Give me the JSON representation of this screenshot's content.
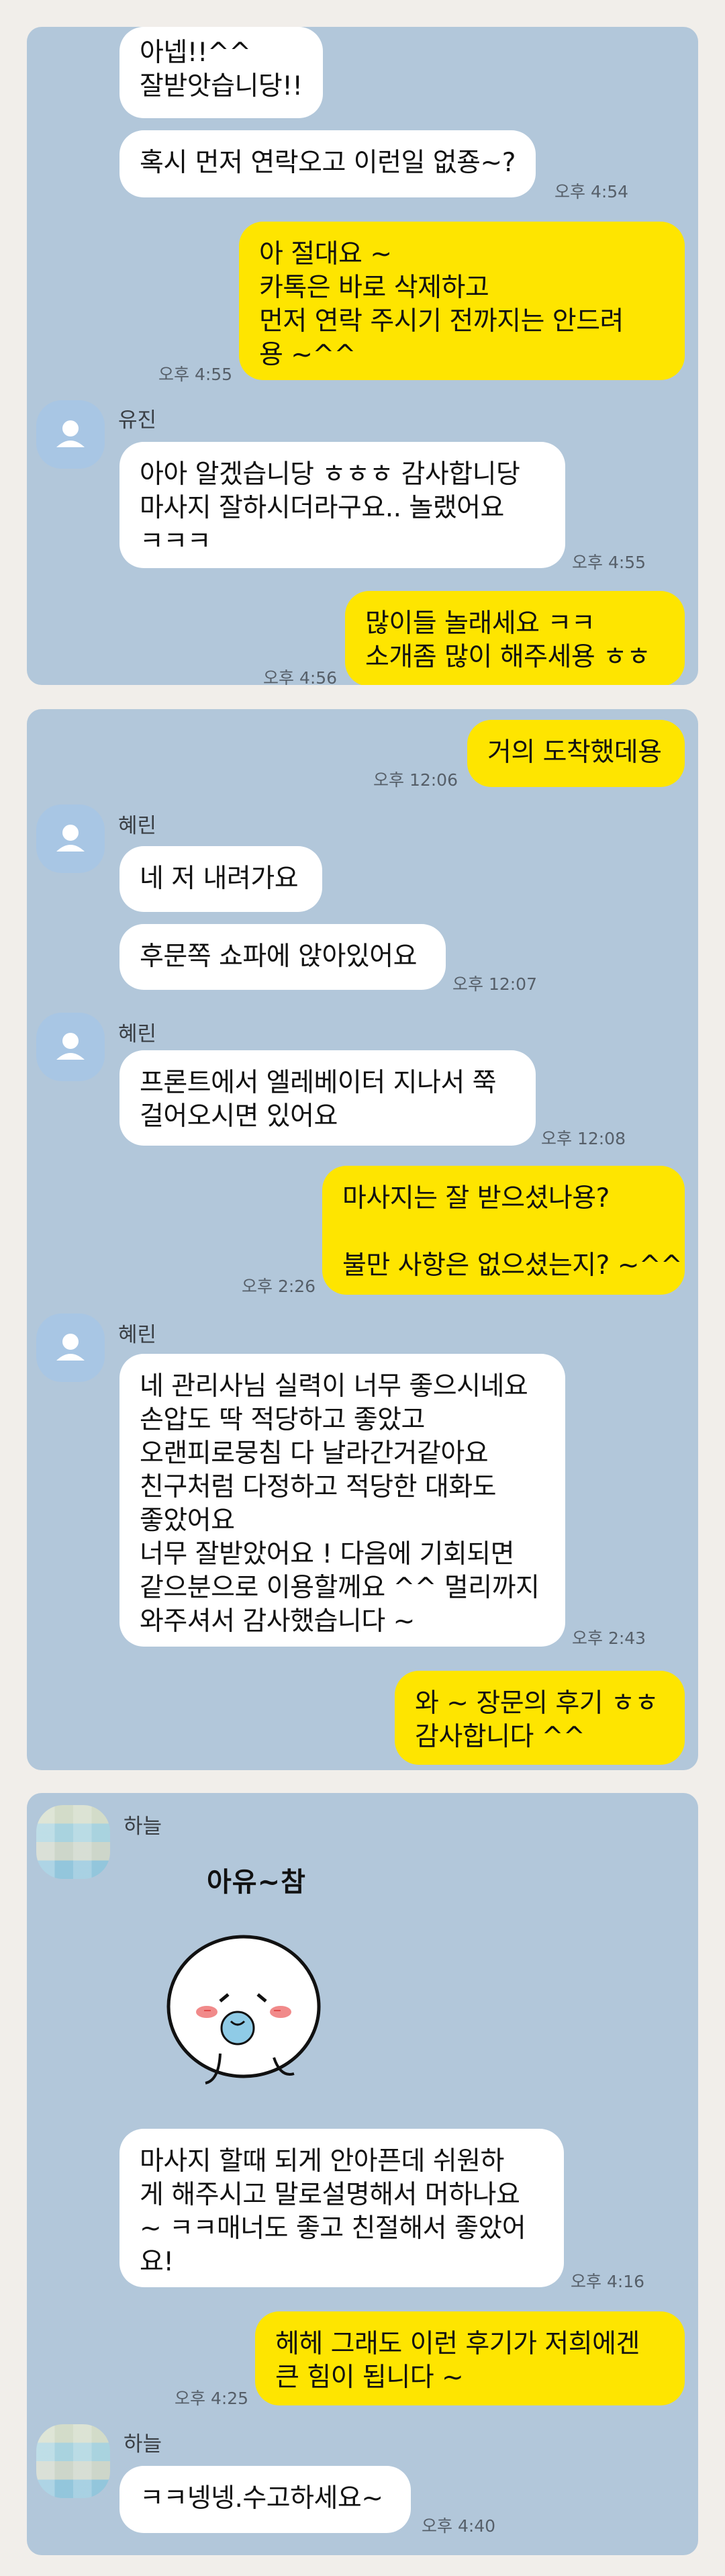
{
  "colors": {
    "chat_bg": "#b2c7da",
    "sent_bubble": "#fee500",
    "received_bubble": "#ffffff",
    "page_bg": "#f1eeea"
  },
  "icons": {
    "default_avatar": "person-icon",
    "blurred_avatar": "pixelated-profile-image"
  },
  "panel1": {
    "m1": "아넵!!^^\n잘받앗습니당!!",
    "m2": "혹시 먼저 연락오고 이런일 없죵~?",
    "t2": "오후 4:54",
    "m3": "아 절대요 ~\n카톡은 바로 삭제하고\n먼저 연락 주시기 전까지는 안드려\n용 ~^^",
    "t3": "오후 4:55",
    "name4": "유진",
    "m4": "아아 알겠습니당 ㅎㅎㅎ 감사합니당\n마사지 잘하시더라구요.. 놀랬어요\nㅋㅋㅋ",
    "t4": "오후 4:55",
    "m5": "많이들 놀래세요 ㅋㅋ\n소개좀 많이 해주세용 ㅎㅎ",
    "t5": "오후 4:56"
  },
  "panel2": {
    "m1": "거의 도착했데용",
    "t1": "오후 12:06",
    "name2": "혜린",
    "m2": "네 저 내려가요",
    "m3": "후문쪽 쇼파에 앉아있어요",
    "t3": "오후 12:07",
    "name4": "혜린",
    "m4": "프론트에서 엘레베이터 지나서 쭉\n걸어오시면 있어요",
    "t4": "오후 12:08",
    "m5": "마사지는 잘 받으셨나용?\n\n불만 사항은 없으셨는지? ~^^",
    "t5": "오후 2:26",
    "name6": "혜린",
    "m6": "네 관리사님 실력이 너무 좋으시네요\n손압도 딱 적당하고 좋았고\n오랜피로뭉침 다 날라간거같아요\n친구처럼 다정하고 적당한 대화도\n좋았어요\n너무 잘받았어요 ! 다음에 기회되면\n같으분으로 이용할께요 ^^ 멀리까지\n와주셔서 감사했습니다 ~",
    "t6": "오후 2:43",
    "m7": "와 ~ 장문의 후기 ㅎㅎ\n감사합니다 ^^"
  },
  "panel3": {
    "name1": "하늘",
    "sticker_text": "아유~참",
    "m1": "마사지 할때 되게 안아픈데 쉬원하\n게 해주시고 말로설명해서 머하나요\n~ ㅋㅋ매너도 좋고 친절해서 좋았어\n요!",
    "t1": "오후 4:16",
    "m2": "헤헤 그래도 이런 후기가 저희에겐\n큰 힘이 됩니다 ~",
    "t2": "오후 4:25",
    "name3": "하늘",
    "m3": "ㅋㅋ넹넹.수고하세요~",
    "t3": "오후 4:40"
  }
}
